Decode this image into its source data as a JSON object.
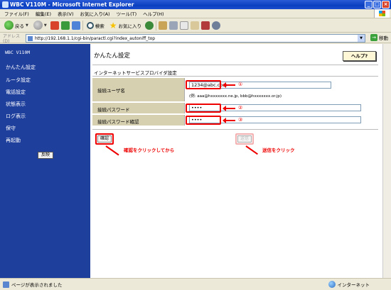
{
  "window": {
    "title": "WBC V110M - Microsoft Internet Explorer"
  },
  "menu": [
    "ファイル(F)",
    "編集(E)",
    "表示(V)",
    "お気に入り(A)",
    "ツール(T)",
    "ヘルプ(H)"
  ],
  "toolbar": {
    "back": "戻る",
    "search": "検索",
    "favorites": "お気に入り"
  },
  "address": {
    "label": "アドレス(D)",
    "url": "http://192.168.1.1/cgi-bin/paractl.cgi?index_autoniff_top",
    "go": "移動"
  },
  "sidebar": {
    "brand": "WBC V110M",
    "items": [
      "かんたん設定",
      "ルータ設定",
      "電話設定",
      "状態表示",
      "ログ表示",
      "保守",
      "再起動"
    ],
    "apply": "反映"
  },
  "main": {
    "title": "かんたん設定",
    "help": "ヘルプ?",
    "section": "インターネットサービスプロバイダ設定",
    "fields": [
      {
        "label": "接続ユーザ名",
        "value": "1234@abc.com",
        "hint": "(例: aaa@hxxxxxxx.ne.jp, bbb@hxxxxxxx.or.jp)",
        "marker": "①"
      },
      {
        "label": "接続パスワード",
        "value": "••••",
        "marker": "②"
      },
      {
        "label": "接続パスワード確認",
        "value": "••••",
        "marker": "③"
      }
    ],
    "confirm": "確認",
    "send": "送信",
    "annotation_confirm": "確認をクリックしてから",
    "annotation_send": "送信をクリック"
  },
  "status": {
    "left": "ページが表示されました",
    "zone": "インターネット"
  },
  "colors": {
    "sidebar": "#1f3f9d",
    "form_bg": "#d6d0b1",
    "annotation": "#e00000",
    "titlebar": "#0a3fbf"
  }
}
